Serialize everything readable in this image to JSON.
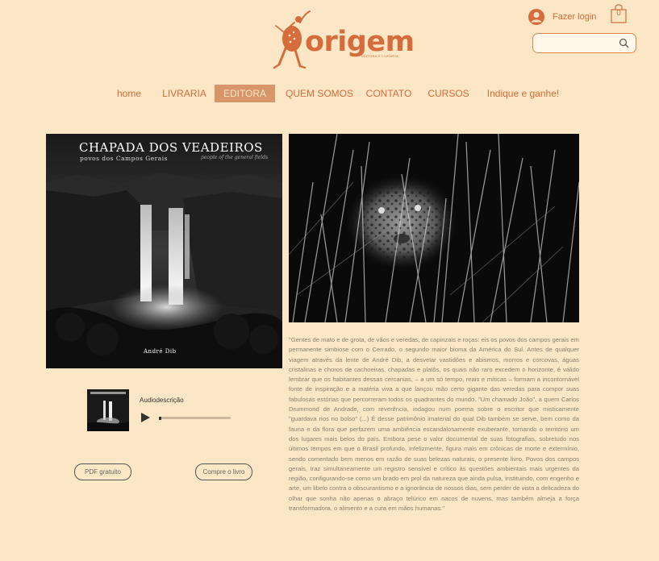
{
  "header": {
    "logo_name": "origem",
    "logo_tagline": "EDITORA E LIVRARIA",
    "login_label": "Fazer login",
    "cart_count": "0",
    "search_placeholder": ""
  },
  "nav": {
    "items": [
      {
        "label": "home",
        "active": false
      },
      {
        "label": "LIVRARIA",
        "active": false
      },
      {
        "label": "EDITORA",
        "active": true
      },
      {
        "label": "QUEM SOMOS",
        "active": false
      },
      {
        "label": "CONTATO",
        "active": false
      },
      {
        "label": "CURSOS",
        "active": false
      },
      {
        "label": "Indique e ganhe!",
        "active": false
      }
    ]
  },
  "book": {
    "cover_title": "CHAPADA DOS VEADEIROS",
    "cover_subtitle": "povos dos Campos Gerais",
    "cover_subtitle_en": "people of the general fields",
    "cover_author": "André Dib"
  },
  "audio": {
    "title": "Audiodescrição",
    "progress": 0
  },
  "buttons": {
    "pdf": "PDF gratuito",
    "buy": "Compre o livro"
  },
  "description": "\"Gentes de mato e de grota, de vãos e veredas, de capinzais e roças: eis os povos dos campos gerais em permanente simbiose com o Cerrado, o segundo maior bioma da América do Sul. Antes de qualquer viagem através da lente de André Dib, a desvelar vastidões e abismos, morros e corcovas, águas cristalinas e choros de cachoeiras, chapadas e platôs, os quais não raro excedem o horizonte, é válido lembrar que os habitantes dessas cercanias, – a um só tempo, reais e míticas – formam a incontornável fonte de inspiração e a matéria viva a que lançou mão certo gigante das veredas para compor suas fabulosas estórias que percorreram todos os quadrantes do mundo. \"Um chamado João\", a quem Carlos Drummond de Andrade, com reverência, indagou num poema sobre o escritor que misticamente \"guardava rios no bolso\" (...) É desse patrimônio imaterial do qual Dib também se serve, bem como da fauna e da flora que perfazem uma ambiência escandalosamente exuberante, tornando o território um dos lugares mais belos do país. Embora pese o valor documental de suas fotografias, sobretudo nos últimos tempos em que o Brasil profundo, infelizmente, figura mais em crônicas de morte e extermínio, sendo comentado bem menos em razão de suas belezas naturais, o presente livro, Povos dos campos gerais, traz simultaneamente um registro sensível e crítico às questões ambientais mais urgentes da região, configurando-se como um brado em prol da natureza que ainda pulsa, instituindo, com engenho e arte, um libelo contra o obscurantismo e a ignorância de nossos dias, sem perder de vista a delicadeza do olhar que sonha não apenas o abraço telúrico em nacos de nuvens, mas também almeja a força transformadora, o alimento e a cura em mãos humanas.\"",
  "colors": {
    "background": "#fbe7c5",
    "accent": "#d66b3b",
    "nav_active": "#d9956a",
    "body_text": "#8a8170"
  }
}
